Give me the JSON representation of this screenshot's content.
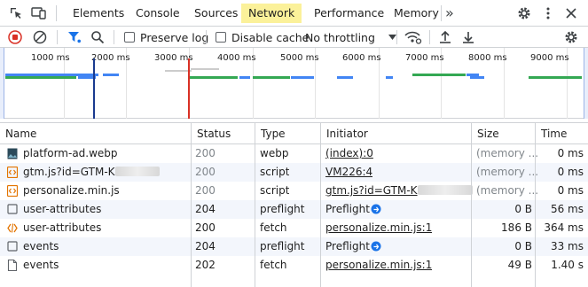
{
  "tabs": {
    "items": [
      "Elements",
      "Console",
      "Sources",
      "Network",
      "Performance",
      "Memory"
    ],
    "active": "Network",
    "more": "»"
  },
  "toolbar": {
    "preserve_log": "Preserve log",
    "disable_cache": "Disable cache",
    "throttling": "No throttling"
  },
  "overview": {
    "ticks": [
      "1000 ms",
      "2000 ms",
      "3000 ms",
      "4000 ms",
      "5000 ms",
      "6000 ms",
      "7000 ms",
      "8000 ms",
      "9000 ms"
    ]
  },
  "table": {
    "headers": [
      "Name",
      "Status",
      "Type",
      "Initiator",
      "Size",
      "Time"
    ],
    "rows": [
      {
        "name": "platform-ad.webp",
        "status": "200",
        "type": "webp",
        "initiator": "(index):0",
        "size": "(memory ...",
        "time": "0 ms",
        "icon": "image-icon"
      },
      {
        "name": "gtm.js?id=GTM-K",
        "status": "200",
        "type": "script",
        "initiator": "VM226:4",
        "size": "(memory ...",
        "time": "0 ms",
        "icon": "script-icon"
      },
      {
        "name": "personalize.min.js",
        "status": "200",
        "type": "script",
        "initiator": "gtm.js?id=GTM-K",
        "size": "(memory ...",
        "time": "0 ms",
        "icon": "script-icon"
      },
      {
        "name": "user-attributes",
        "status": "204",
        "type": "preflight",
        "initiator": "Preflight",
        "size": "0 B",
        "time": "56 ms",
        "icon": "checkbox-icon"
      },
      {
        "name": "user-attributes",
        "status": "200",
        "type": "fetch",
        "initiator": "personalize.min.js:1",
        "size": "186 B",
        "time": "364 ms",
        "icon": "fetch-icon"
      },
      {
        "name": "events",
        "status": "204",
        "type": "preflight",
        "initiator": "Preflight",
        "size": "0 B",
        "time": "33 ms",
        "icon": "checkbox-icon"
      },
      {
        "name": "events",
        "status": "202",
        "type": "fetch",
        "initiator": "personalize.min.js:1",
        "size": "49 B",
        "time": "1.40 s",
        "icon": "document-icon"
      }
    ]
  },
  "colors": {
    "active_tab": "#fbf19a",
    "record": "#d93025",
    "accent": "#1a73e8",
    "green_bar": "#34a853",
    "blue_bar": "#4285f4",
    "red_line": "#d93025",
    "blue_line": "#1a3a8f"
  }
}
